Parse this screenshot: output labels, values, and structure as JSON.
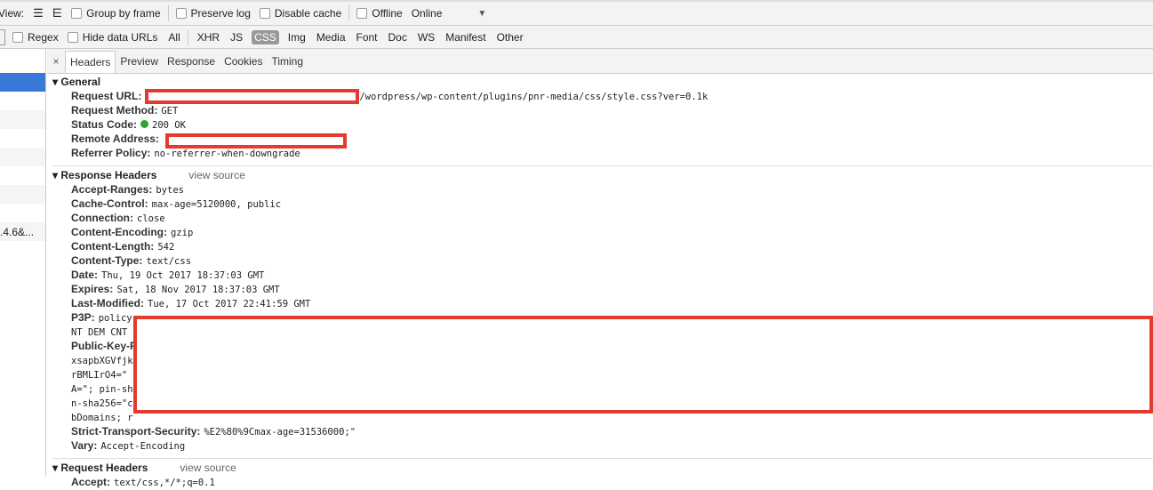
{
  "toolbar": {
    "view_label": "View:",
    "group_by_frame": "Group by frame",
    "preserve_log": "Preserve log",
    "disable_cache": "Disable cache",
    "offline": "Offline",
    "throttle": "Online",
    "dropdown_icon": "▼"
  },
  "filters": {
    "regex": "Regex",
    "hide_data_urls": "Hide data URLs",
    "types": [
      "All",
      "XHR",
      "JS",
      "CSS",
      "Img",
      "Media",
      "Font",
      "Doc",
      "WS",
      "Manifest",
      "Other"
    ],
    "active": "CSS"
  },
  "request_list": {
    "visible_row_text": ".4.6&..."
  },
  "tabs": {
    "close": "×",
    "items": [
      "Headers",
      "Preview",
      "Response",
      "Cookies",
      "Timing"
    ],
    "active": "Headers"
  },
  "general": {
    "title": "General",
    "rows": [
      {
        "key": "Request URL:",
        "value": "/wordpress/wp-content/plugins/pnr-media/css/style.css?ver=0.1k"
      },
      {
        "key": "Request Method:",
        "value": "GET"
      },
      {
        "key": "Status Code:",
        "value": "200 OK"
      },
      {
        "key": "Remote Address:",
        "value": ""
      },
      {
        "key": "Referrer Policy:",
        "value": "no-referrer-when-downgrade"
      }
    ]
  },
  "response_headers": {
    "title": "Response Headers",
    "view_source": "view source",
    "rows": [
      {
        "key": "Accept-Ranges:",
        "value": "bytes"
      },
      {
        "key": "Cache-Control:",
        "value": "max-age=5120000, public"
      },
      {
        "key": "Connection:",
        "value": "close"
      },
      {
        "key": "Content-Encoding:",
        "value": "gzip"
      },
      {
        "key": "Content-Length:",
        "value": "542"
      },
      {
        "key": "Content-Type:",
        "value": "text/css"
      },
      {
        "key": "Date:",
        "value": "Thu, 19 Oct 2017 18:37:03 GMT"
      },
      {
        "key": "Expires:",
        "value": "Sat, 18 Nov 2017 18:37:03 GMT"
      },
      {
        "key": "Last-Modified:",
        "value": "Tue, 17 Oct 2017 22:41:59 GMT"
      },
      {
        "key": "P3P:",
        "value": "policy"
      }
    ],
    "wrapped": [
      "NT DEM CNT",
      "xsapbXGVfjk",
      "rBMLIrO4=\"",
      "A=\"; pin-sh",
      "n-sha256=\"c",
      "bDomains; r"
    ],
    "public_key_key": "Public-Key-P",
    "tail": [
      {
        "key": "Strict-Transport-Security:",
        "value": "%E2%80%9Cmax-age=31536000;\""
      },
      {
        "key": "Vary:",
        "value": "Accept-Encoding"
      }
    ]
  },
  "request_headers": {
    "title": "Request Headers",
    "view_source": "view source",
    "rows": [
      {
        "key": "Accept:",
        "value": "text/css,*/*;q=0.1"
      }
    ]
  }
}
